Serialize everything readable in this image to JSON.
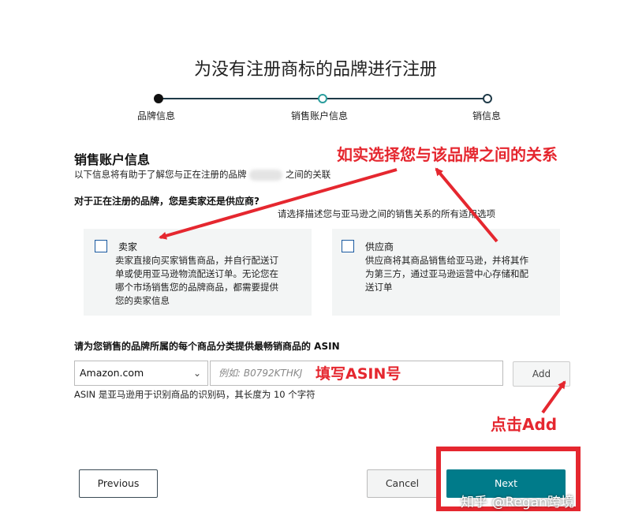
{
  "page": {
    "title": "为没有注册商标的品牌进行注册"
  },
  "steps": [
    {
      "label": "品牌信息"
    },
    {
      "label": "销售账户信息"
    },
    {
      "label": "销信息"
    }
  ],
  "section": {
    "heading": "销售账户信息",
    "desc_before": "以下信息将有助于了解您与正在注册的品牌",
    "desc_after": "之间的关联",
    "question": "对于正在注册的品牌，您是卖家还是供应商?",
    "hint": "请选择描述您与亚马逊之间的销售关系的所有适用选项"
  },
  "options": {
    "seller": {
      "title": "卖家",
      "lines": [
        "卖家直接向买家销售商品，并自行配送订",
        "单或使用亚马逊物流配送订单。无论您在",
        "哪个市场销售您的品牌商品，都需要提供",
        "您的卖家信息"
      ]
    },
    "vendor": {
      "title": "供应商",
      "lines": [
        "供应商将其商品销售给亚马逊，并将其作",
        "为第三方，通过亚马逊运营中心存储和配",
        "送订单"
      ]
    }
  },
  "asin": {
    "label": "请为您销售的品牌所属的每个商品分类提供最畅销商品的 ASIN",
    "marketplace": "Amazon.com",
    "placeholder": "例如: B0792KTHKJ",
    "add_label": "Add",
    "note": "ASIN 是亚马逊用于识别商品的识别码，其长度为 10 个字符"
  },
  "buttons": {
    "previous": "Previous",
    "cancel": "Cancel",
    "next": "Next"
  },
  "annotations": {
    "relationship": "如实选择您与该品牌之间的关系",
    "fill_asin": "填写ASIN号",
    "click_add": "点击Add"
  },
  "watermark": "知乎 @Regan跨境",
  "colors": {
    "accent": "#007b8a",
    "annotation": "#e5272f",
    "step_line": "#1f3a48"
  }
}
